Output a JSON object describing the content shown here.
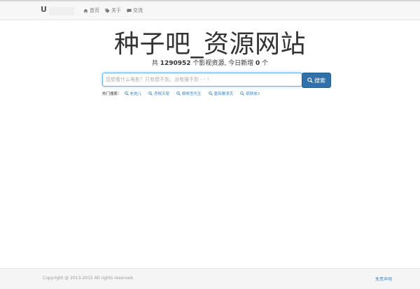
{
  "nav": {
    "logo_text": "U",
    "items": [
      {
        "label": "首页",
        "icon": "home-icon"
      },
      {
        "label": "关于",
        "icon": "tags-icon"
      },
      {
        "label": "交流",
        "icon": "comment-icon"
      }
    ]
  },
  "hero": {
    "title": "种子吧_资源网站",
    "sub_prefix": "共",
    "total": "1290952",
    "sub_middle": "个影视资源, 今日新增",
    "today": "0",
    "sub_suffix": "个"
  },
  "search": {
    "placeholder": "您想看什么电影？只有想不到，没有搜不到 - - !",
    "button_label": "搜索"
  },
  "hot": {
    "label": "热门搜索：",
    "items": [
      "老炮儿",
      "恶棍天使",
      "解救吾先生",
      "唐探覆浪克",
      "钢铁侠3"
    ]
  },
  "footer": {
    "copyright": "Copyright @ 2013-2015 All rights reserved.",
    "disclaimer": "免责声明"
  },
  "colors": {
    "accent": "#3071a9",
    "link": "#428bca"
  }
}
